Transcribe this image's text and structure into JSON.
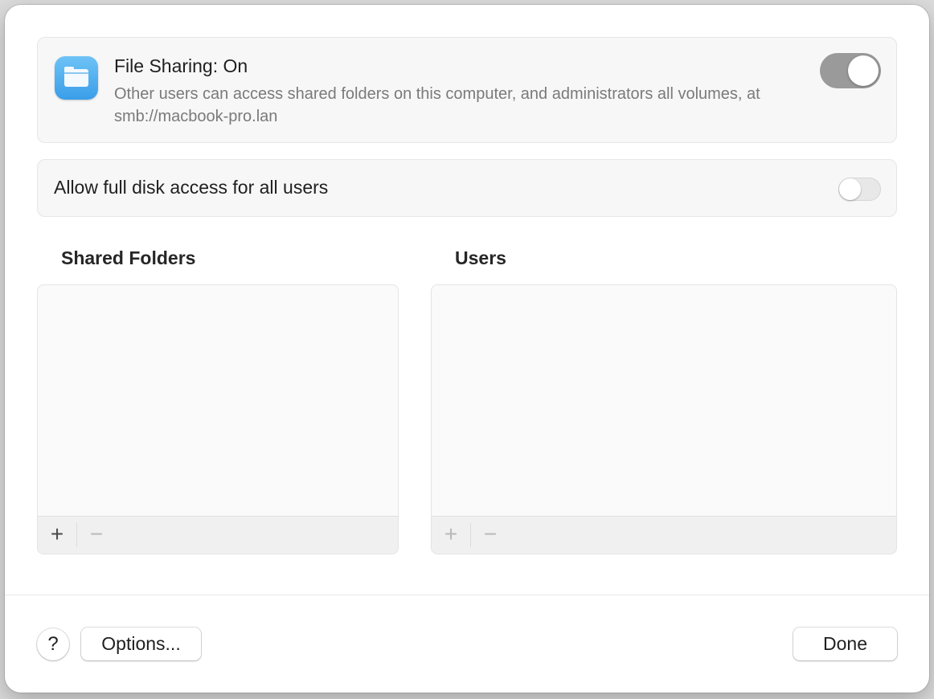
{
  "file_sharing": {
    "title": "File Sharing: On",
    "description": "Other users can access shared folders on this computer, and administrators all volumes, at smb://macbook-pro.lan",
    "enabled": true,
    "icon": "folder-icon"
  },
  "full_disk_access": {
    "label": "Allow full disk access for all users",
    "enabled": false
  },
  "shared_folders": {
    "title": "Shared Folders",
    "items": [],
    "add_label": "+",
    "remove_label": "−"
  },
  "users": {
    "title": "Users",
    "items": [],
    "add_label": "+",
    "remove_label": "−"
  },
  "footer": {
    "help_label": "?",
    "options_label": "Options...",
    "done_label": "Done"
  }
}
